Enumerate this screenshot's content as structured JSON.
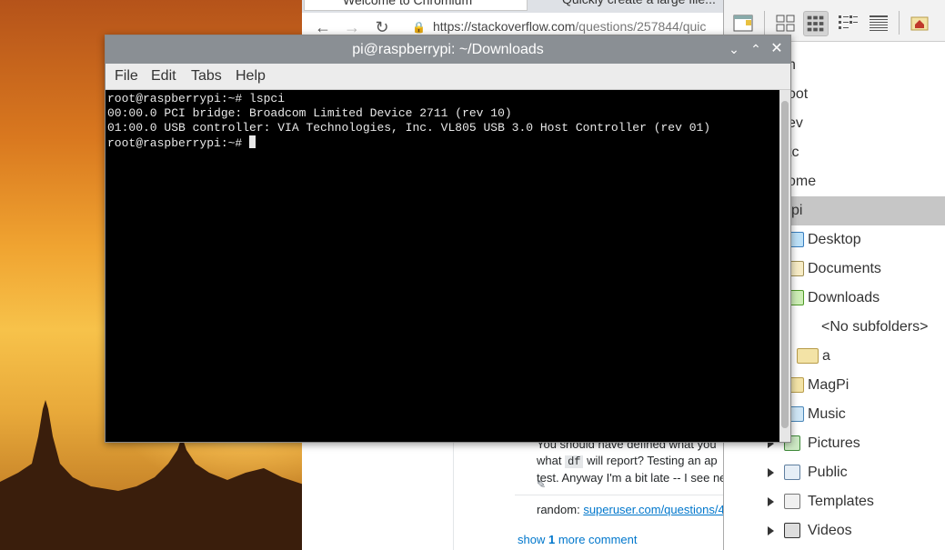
{
  "browser": {
    "tabs": [
      {
        "label": "Welcome to Chromium"
      },
      {
        "label": "Quickly create a large file..."
      }
    ],
    "url": {
      "host": "https://stackoverflow.com",
      "path": "/questions/257844/quic"
    },
    "comment": {
      "line1": "You should have defined what you",
      "line2_pre": "what ",
      "line2_code": "df",
      "line2_post": " will report? Testing an ap",
      "line3": "test. Anyway I'm a bit late -- I see ne"
    },
    "random_label": "random: ",
    "random_link": "superuser.com/questions/4",
    "show_more": {
      "pre": "show ",
      "count": "1",
      "post": " more comment"
    }
  },
  "terminal": {
    "title": "pi@raspberrypi: ~/Downloads",
    "menu": [
      "File",
      "Edit",
      "Tabs",
      "Help"
    ],
    "lines": [
      "root@raspberrypi:~# lspci",
      "00:00.0 PCI bridge: Broadcom Limited Device 2711 (rev 10)",
      "01:00.0 USB controller: VIA Technologies, Inc. VL805 USB 3.0 Host Controller (rev 01)"
    ],
    "prompt": "root@raspberrypi:~# "
  },
  "filemanager": {
    "tree": [
      {
        "label": "n",
        "icon": "",
        "selected": false,
        "expander": false
      },
      {
        "label": "oot",
        "icon": "",
        "selected": false,
        "expander": false
      },
      {
        "label": "ev",
        "icon": "",
        "selected": false,
        "expander": false
      },
      {
        "label": "tc",
        "icon": "",
        "selected": false,
        "expander": false
      },
      {
        "label": "ome",
        "icon": "",
        "selected": false,
        "expander": false
      },
      {
        "label": "pi",
        "icon": "",
        "selected": true,
        "expander": false
      },
      {
        "label": "Desktop",
        "icon": "desktop",
        "selected": false,
        "expander": false
      },
      {
        "label": "Documents",
        "icon": "docs",
        "selected": false,
        "expander": false
      },
      {
        "label": "Downloads",
        "icon": "dl",
        "selected": false,
        "expander": false
      },
      {
        "label": "<No subfolders>",
        "icon": "",
        "selected": false,
        "expander": false
      },
      {
        "label": "a",
        "icon": "folder",
        "selected": false,
        "expander": false
      },
      {
        "label": "MagPi",
        "icon": "folder",
        "selected": false,
        "expander": false
      },
      {
        "label": "Music",
        "icon": "music",
        "selected": false,
        "expander": false
      },
      {
        "label": "Pictures",
        "icon": "pics",
        "selected": false,
        "expander": true
      },
      {
        "label": "Public",
        "icon": "public",
        "selected": false,
        "expander": true
      },
      {
        "label": "Templates",
        "icon": "tmpl",
        "selected": false,
        "expander": true
      },
      {
        "label": "Videos",
        "icon": "vids",
        "selected": false,
        "expander": true
      }
    ]
  }
}
